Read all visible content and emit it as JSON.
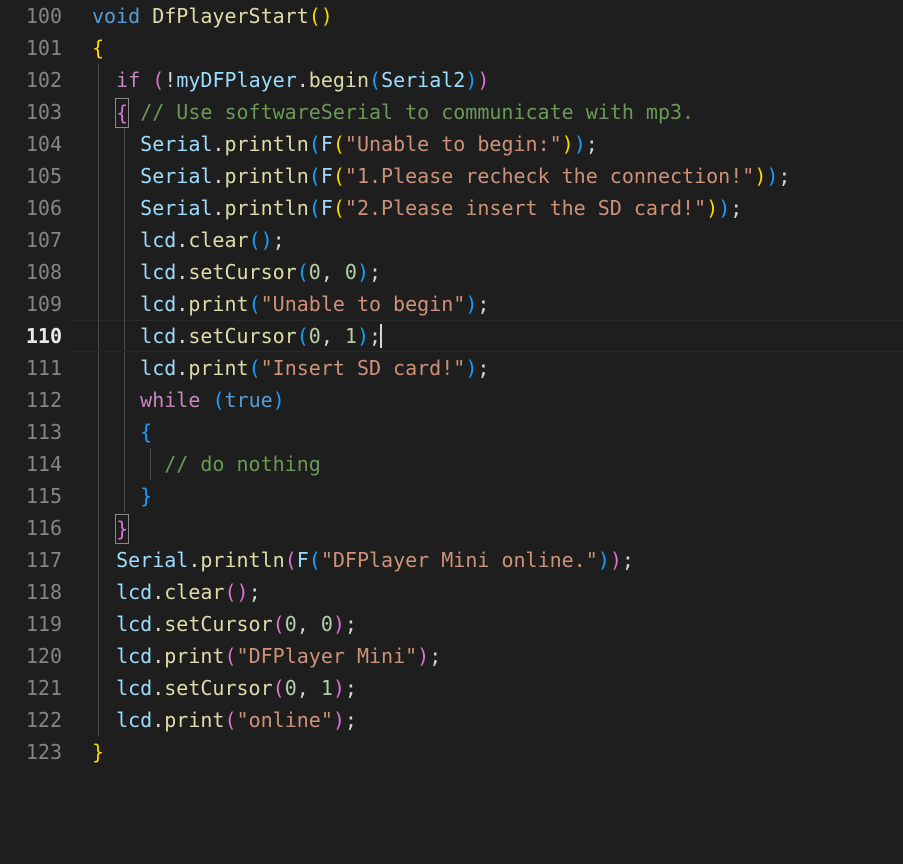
{
  "editor": {
    "theme": "dark-plus",
    "language": "cpp",
    "background": "#1e1e1e",
    "active_line": 110,
    "cursor_line": 110,
    "first_visible_line": 100,
    "last_visible_line": 123,
    "colors": {
      "background": "#1e1e1e",
      "foreground": "#d4d4d4",
      "line_number": "#858585",
      "line_number_active": "#e8e8e8",
      "keyword": "#569cd6",
      "control_keyword": "#c586c0",
      "function": "#dcdcaa",
      "variable": "#9cdcfe",
      "string": "#ce9178",
      "number": "#b5cea8",
      "comment": "#6a9955",
      "bracket_depth_1": "#ffd700",
      "bracket_depth_2": "#da70d6",
      "bracket_depth_3": "#179fff",
      "indent_guide": "#4a4a4a",
      "bracket_match_border": "#888888",
      "cursor": "#d8d8d8"
    }
  },
  "lines": [
    {
      "n": "100",
      "text": "void DfPlayerStart()"
    },
    {
      "n": "101",
      "text": "{"
    },
    {
      "n": "102",
      "text": "  if (!myDFPlayer.begin(Serial2))"
    },
    {
      "n": "103",
      "text": "  { // Use softwareSerial to communicate with mp3."
    },
    {
      "n": "104",
      "text": "    Serial.println(F(\"Unable to begin:\"));"
    },
    {
      "n": "105",
      "text": "    Serial.println(F(\"1.Please recheck the connection!\"));"
    },
    {
      "n": "106",
      "text": "    Serial.println(F(\"2.Please insert the SD card!\"));"
    },
    {
      "n": "107",
      "text": "    lcd.clear();"
    },
    {
      "n": "108",
      "text": "    lcd.setCursor(0, 0);"
    },
    {
      "n": "109",
      "text": "    lcd.print(\"Unable to begin\");"
    },
    {
      "n": "110",
      "text": "    lcd.setCursor(0, 1);"
    },
    {
      "n": "111",
      "text": "    lcd.print(\"Insert SD card!\");"
    },
    {
      "n": "112",
      "text": "    while (true)"
    },
    {
      "n": "113",
      "text": "    {"
    },
    {
      "n": "114",
      "text": "      // do nothing"
    },
    {
      "n": "115",
      "text": "    }"
    },
    {
      "n": "116",
      "text": "  }"
    },
    {
      "n": "117",
      "text": "  Serial.println(F(\"DFPlayer Mini online.\"));"
    },
    {
      "n": "118",
      "text": "  lcd.clear();"
    },
    {
      "n": "119",
      "text": "  lcd.setCursor(0, 0);"
    },
    {
      "n": "120",
      "text": "  lcd.print(\"DFPlayer Mini\");"
    },
    {
      "n": "121",
      "text": "  lcd.setCursor(0, 1);"
    },
    {
      "n": "122",
      "text": "  lcd.print(\"online\");"
    },
    {
      "n": "123",
      "text": "}"
    }
  ]
}
